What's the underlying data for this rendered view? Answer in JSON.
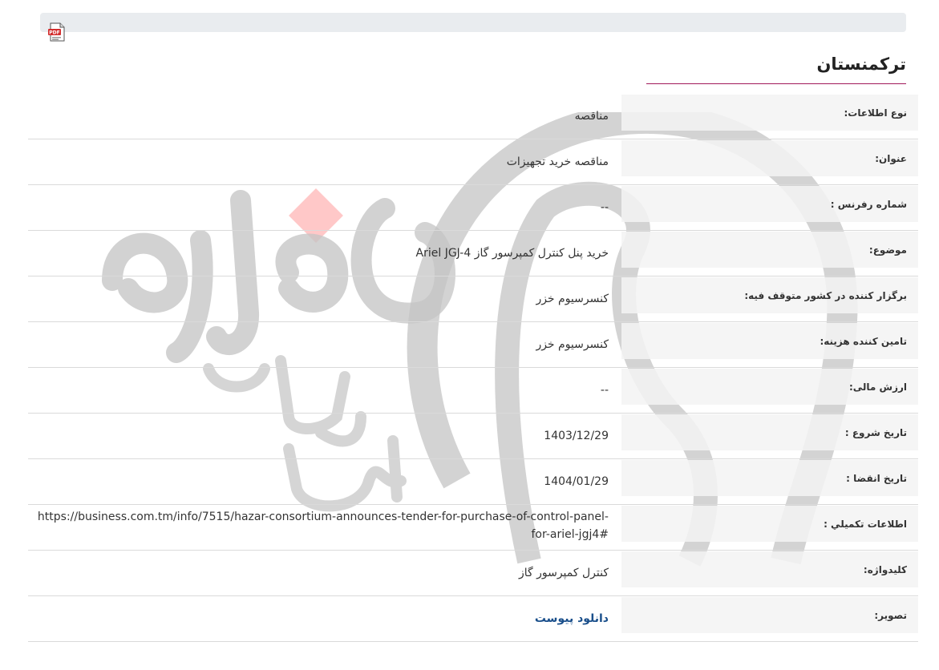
{
  "pdf_icon": "pdf-file-icon",
  "page_title": "ترکمنستان",
  "watermark": {
    "text_line1": "هزاره",
    "text_line2": "گستران",
    "text_line3": "ارتباط"
  },
  "rows": [
    {
      "label": "نوع اطلاعات:",
      "value": "مناقصه"
    },
    {
      "label": "عنوان:",
      "value": "مناقصه خرید تجهیزات"
    },
    {
      "label": "شماره رفرنس :",
      "value": "--"
    },
    {
      "label": "موضوع:",
      "value": "خرید پنل کنترل کمپرسور گاز Ariel JGJ-4"
    },
    {
      "label": "برگزار کننده در کشور متوقف فیه:",
      "value": "کنسرسیوم خزر"
    },
    {
      "label": "تامین کننده هزینه:",
      "value": "کنسرسیوم خزر"
    },
    {
      "label": "ارزش مالی:",
      "value": "--"
    },
    {
      "label": "تاریخ شروع :",
      "value": "1403/12/29"
    },
    {
      "label": "تاریخ انقضا :",
      "value": "1404/01/29"
    },
    {
      "label": "اطلاعات تكميلي :",
      "value": "https://business.com.tm/info/7515/hazar-consortium-announces-tender-for-purchase-of-control-panel-for-ariel-jgj4#"
    },
    {
      "label": "کلیدواژه:",
      "value": "کنترل کمپرسور گاز"
    },
    {
      "label": "تصویر:",
      "value": "دانلود پیوست"
    }
  ],
  "colors": {
    "accent_underline": "#a11a5b",
    "link": "#1a4f8b",
    "label_bg": "#f3f3f3",
    "watermark_red": "#ff9a9a",
    "watermark_gray": "#c8c8c8"
  }
}
